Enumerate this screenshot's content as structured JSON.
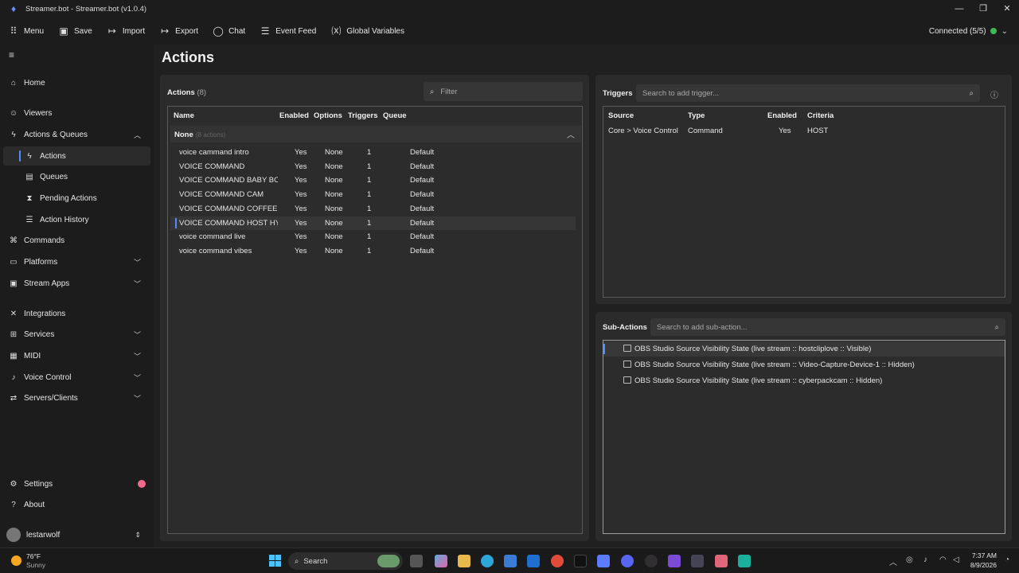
{
  "window": {
    "title": "Streamer.bot - Streamer.bot (v1.0.4)",
    "controls": [
      "—",
      "❐",
      "✕"
    ]
  },
  "toolbar": {
    "items": [
      {
        "icon": "grid-icon",
        "label": "Menu"
      },
      {
        "icon": "save-icon",
        "label": "Save"
      },
      {
        "icon": "import-icon",
        "label": "Import"
      },
      {
        "icon": "export-icon",
        "label": "Export"
      },
      {
        "icon": "chat-icon",
        "label": "Chat"
      },
      {
        "icon": "event-feed-icon",
        "label": "Event Feed"
      },
      {
        "icon": "variables-icon",
        "label": "Global Variables"
      }
    ],
    "connection": "Connected (5/5)",
    "connection_color": "#3fb950"
  },
  "sidebar": {
    "items": [
      {
        "label": "Home",
        "icon": "home-icon"
      },
      {
        "label": "Viewers",
        "icon": "viewers-icon"
      },
      {
        "label": "Actions & Queues",
        "icon": "actions-icon",
        "chevron": "up"
      },
      {
        "label": "Actions",
        "icon": "action-icon",
        "sub": true,
        "active": true
      },
      {
        "label": "Queues",
        "icon": "queue-icon",
        "sub": true
      },
      {
        "label": "Pending Actions",
        "icon": "pending-icon",
        "sub": true
      },
      {
        "label": "Action History",
        "icon": "history-icon",
        "sub": true
      },
      {
        "label": "Commands",
        "icon": "command-icon"
      },
      {
        "label": "Platforms",
        "icon": "platforms-icon",
        "chevron": "down"
      },
      {
        "label": "Stream Apps",
        "icon": "stream-apps-icon",
        "chevron": "down"
      },
      {
        "label": "Integrations",
        "icon": "integrations-icon"
      },
      {
        "label": "Services",
        "icon": "services-icon",
        "chevron": "down"
      },
      {
        "label": "MIDI",
        "icon": "midi-icon",
        "chevron": "down"
      },
      {
        "label": "Voice Control",
        "icon": "voice-icon",
        "chevron": "down"
      },
      {
        "label": "Servers/Clients",
        "icon": "servers-icon",
        "chevron": "down"
      }
    ],
    "settings": "Settings",
    "about": "About",
    "user": "lestarwolf"
  },
  "page": {
    "title": "Actions"
  },
  "actions": {
    "header": "Actions",
    "count": "(8)",
    "filter_placeholder": "Filter",
    "columns": [
      "Name",
      "Enabled",
      "Options",
      "Triggers",
      "Queue"
    ],
    "group": {
      "name": "None",
      "count": "(8 actions)"
    },
    "rows": [
      {
        "name": "voice cammand intro",
        "enabled": "Yes",
        "options": "None",
        "triggers": "1",
        "queue": "Default"
      },
      {
        "name": "VOICE COMMAND",
        "enabled": "Yes",
        "options": "None",
        "triggers": "1",
        "queue": "Default"
      },
      {
        "name": "VOICE COMMAND BABY BOY",
        "enabled": "Yes",
        "options": "None",
        "triggers": "1",
        "queue": "Default"
      },
      {
        "name": "VOICE COMMAND CAM",
        "enabled": "Yes",
        "options": "None",
        "triggers": "1",
        "queue": "Default"
      },
      {
        "name": "VOICE COMMAND COFFEE",
        "enabled": "Yes",
        "options": "None",
        "triggers": "1",
        "queue": "Default"
      },
      {
        "name": "VOICE COMMAND HOST HYPE",
        "enabled": "Yes",
        "options": "None",
        "triggers": "1",
        "queue": "Default",
        "selected": true
      },
      {
        "name": "voice command live",
        "enabled": "Yes",
        "options": "None",
        "triggers": "1",
        "queue": "Default"
      },
      {
        "name": "voice command vibes",
        "enabled": "Yes",
        "options": "None",
        "triggers": "1",
        "queue": "Default"
      }
    ]
  },
  "triggers": {
    "header": "Triggers",
    "search_placeholder": "Search to add trigger...",
    "columns": [
      "Source",
      "Type",
      "Enabled",
      "Criteria"
    ],
    "rows": [
      {
        "source": "Core > Voice Control",
        "type": "Command",
        "enabled": "Yes",
        "criteria": "HOST"
      }
    ]
  },
  "subactions": {
    "header": "Sub-Actions",
    "search_placeholder": "Search to add sub-action...",
    "items": [
      "OBS Studio Source Visibility State (live stream :: hostcliplove :: Visible)",
      "OBS Studio Source Visibility State (live stream :: Video-Capture-Device-1 :: Hidden)",
      "OBS Studio Source Visibility State (live stream :: cyberpackcam :: Hidden)"
    ]
  },
  "taskbar": {
    "weather_temp": "76°F",
    "weather_desc": "Sunny",
    "search": "Search",
    "time": "7:37 AM",
    "date": "8/9/2026"
  },
  "colors": {
    "accent": "#4f8cff",
    "settings_badge": "#f06a8a"
  }
}
